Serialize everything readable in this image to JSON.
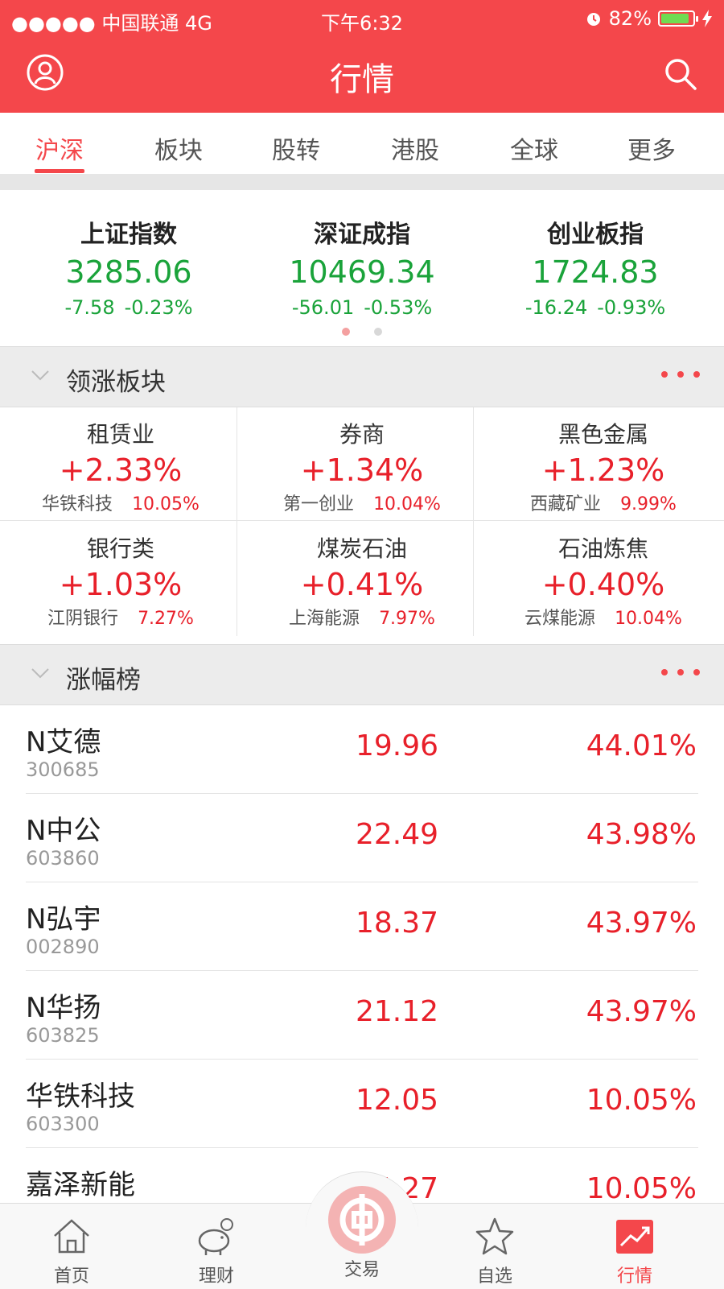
{
  "status_bar": {
    "carrier": "●●●●● 中国联通  4G",
    "time": "下午6:32",
    "battery": "82%",
    "battery_level": 0.82
  },
  "header": {
    "title": "行情"
  },
  "tabs": [
    {
      "label": "沪深",
      "active": true
    },
    {
      "label": "板块"
    },
    {
      "label": "股转"
    },
    {
      "label": "港股"
    },
    {
      "label": "全球"
    },
    {
      "label": "更多"
    }
  ],
  "indices": [
    {
      "name": "上证指数",
      "value": "3285.06",
      "change": "-7.58",
      "pct": "-0.23%"
    },
    {
      "name": "深证成指",
      "value": "10469.34",
      "change": "-56.01",
      "pct": "-0.53%"
    },
    {
      "name": "创业板指",
      "value": "1724.83",
      "change": "-16.24",
      "pct": "-0.93%"
    }
  ],
  "sections": {
    "leading_sectors": "领涨板块",
    "top_gainers": "涨幅榜"
  },
  "sectors": [
    {
      "name": "租赁业",
      "pct": "+2.33%",
      "stock": "华铁科技",
      "stock_pct": "10.05%"
    },
    {
      "name": "券商",
      "pct": "+1.34%",
      "stock": "第一创业",
      "stock_pct": "10.04%"
    },
    {
      "name": "黑色金属",
      "pct": "+1.23%",
      "stock": "西藏矿业",
      "stock_pct": "9.99%"
    },
    {
      "name": "银行类",
      "pct": "+1.03%",
      "stock": "江阴银行",
      "stock_pct": "7.27%"
    },
    {
      "name": "煤炭石油",
      "pct": "+0.41%",
      "stock": "上海能源",
      "stock_pct": "7.97%"
    },
    {
      "name": "石油炼焦",
      "pct": "+0.40%",
      "stock": "云煤能源",
      "stock_pct": "10.04%"
    }
  ],
  "gainers": [
    {
      "name": "N艾德",
      "code": "300685",
      "price": "19.96",
      "pct": "44.01%"
    },
    {
      "name": "N中公",
      "code": "603860",
      "price": "22.49",
      "pct": "43.98%"
    },
    {
      "name": "N弘宇",
      "code": "002890",
      "price": "18.37",
      "pct": "43.97%"
    },
    {
      "name": "N华扬",
      "code": "603825",
      "price": "21.12",
      "pct": "43.97%"
    },
    {
      "name": "华铁科技",
      "code": "603300",
      "price": "12.05",
      "pct": "10.05%"
    },
    {
      "name": "嘉泽新能",
      "code": "",
      "price": "4.27",
      "pct": "10.05%"
    }
  ],
  "bottom_nav": [
    {
      "label": "首页",
      "icon": "home-icon"
    },
    {
      "label": "理财",
      "icon": "piggy-bank-icon"
    },
    {
      "label": "交易",
      "icon": "bank-logo-icon"
    },
    {
      "label": "自选",
      "icon": "star-icon"
    },
    {
      "label": "行情",
      "icon": "trend-chart-icon",
      "active": true
    }
  ],
  "colors": {
    "brand": "#f4474b",
    "up": "#e8202a",
    "down": "#1aa33a"
  }
}
